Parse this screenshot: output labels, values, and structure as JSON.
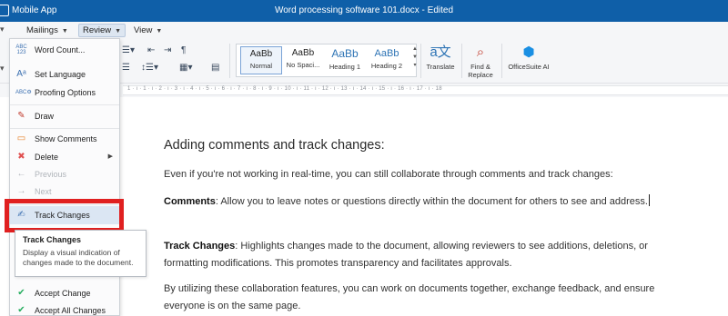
{
  "titlebar": {
    "app_name": "Mobile App",
    "document_title": "Word processing software 101.docx - Edited"
  },
  "menubar": {
    "tabs": [
      {
        "label": "Mailings"
      },
      {
        "label": "Review"
      },
      {
        "label": "View"
      }
    ]
  },
  "ribbon": {
    "styles": [
      {
        "preview": "AaBb",
        "name": "Normal"
      },
      {
        "preview": "AaBb",
        "name": "No Spaci..."
      },
      {
        "preview": "AaBb",
        "name": "Heading 1"
      },
      {
        "preview": "AaBb",
        "name": "Heading 2"
      }
    ],
    "translate_label": "Translate",
    "find_replace_label_1": "Find &",
    "find_replace_label_2": "Replace",
    "ai_label": "OfficeSuite AI",
    "style_colors": {
      "heading_blue": "#2e74b5",
      "selected_border": "#7aa3d6"
    }
  },
  "ruler": {
    "ticks": "1 · ı · 1 · ı · 2 · ı · 3 · ı · 4 · ı · 5 · ı · 6 · ı · 7 · ı · 8 · ı · 9 · ı · 10 · ı · 11 · ı · 12 · ı · 13 · ı · 14 · ı · 15 · ı · 16 · ı · 17 · ı · 18"
  },
  "review_menu": {
    "items": [
      {
        "label": "Word Count...",
        "icon": "word-count-icon",
        "icon_glyph": "ABC\n123"
      },
      {
        "label": "Set Language",
        "icon": "language-icon",
        "icon_glyph": "A☷"
      },
      {
        "label": "Proofing Options",
        "icon": "proofing-icon",
        "icon_glyph": "ABC"
      },
      {
        "label": "Draw",
        "icon": "draw-icon",
        "icon_glyph": "✎"
      },
      {
        "label": "Show Comments",
        "icon": "comment-icon",
        "icon_glyph": "▭"
      },
      {
        "label": "Delete",
        "icon": "delete-comment-icon",
        "icon_glyph": "✖",
        "submenu": true
      },
      {
        "label": "Previous",
        "icon": "previous-icon",
        "icon_glyph": "←",
        "disabled": true
      },
      {
        "label": "Next",
        "icon": "next-icon",
        "icon_glyph": "→",
        "disabled": true
      },
      {
        "label": "Track Changes",
        "icon": "track-changes-icon",
        "icon_glyph": "✍",
        "highlighted": true
      },
      {
        "label": "Accept Change",
        "icon": "accept-change-icon",
        "icon_glyph": "✔"
      },
      {
        "label": "Accept All Changes",
        "icon": "accept-all-icon",
        "icon_glyph": "✔"
      }
    ],
    "submenu_arrow": "▶"
  },
  "tooltip": {
    "title": "Track Changes",
    "text": "Display a visual indication of changes made to the document."
  },
  "highlight_color": "#e02020",
  "document": {
    "heading": "Adding comments and track changes:",
    "intro": "Even if you're not working in real-time, you can still collaborate through comments and track changes:",
    "comments_term": "Comments",
    "comments_text": ": Allow you to leave notes or questions directly within the document for others to see and address.",
    "track_term": "Track Changes",
    "track_text": ": Highlights changes made to the document, allowing reviewers to see additions, deletions, or formatting modifications. This promotes transparency and facilitates approvals.",
    "closing": "By utilizing these collaboration features, you can work on documents together, exchange feedback, and ensure everyone is on the same page."
  }
}
